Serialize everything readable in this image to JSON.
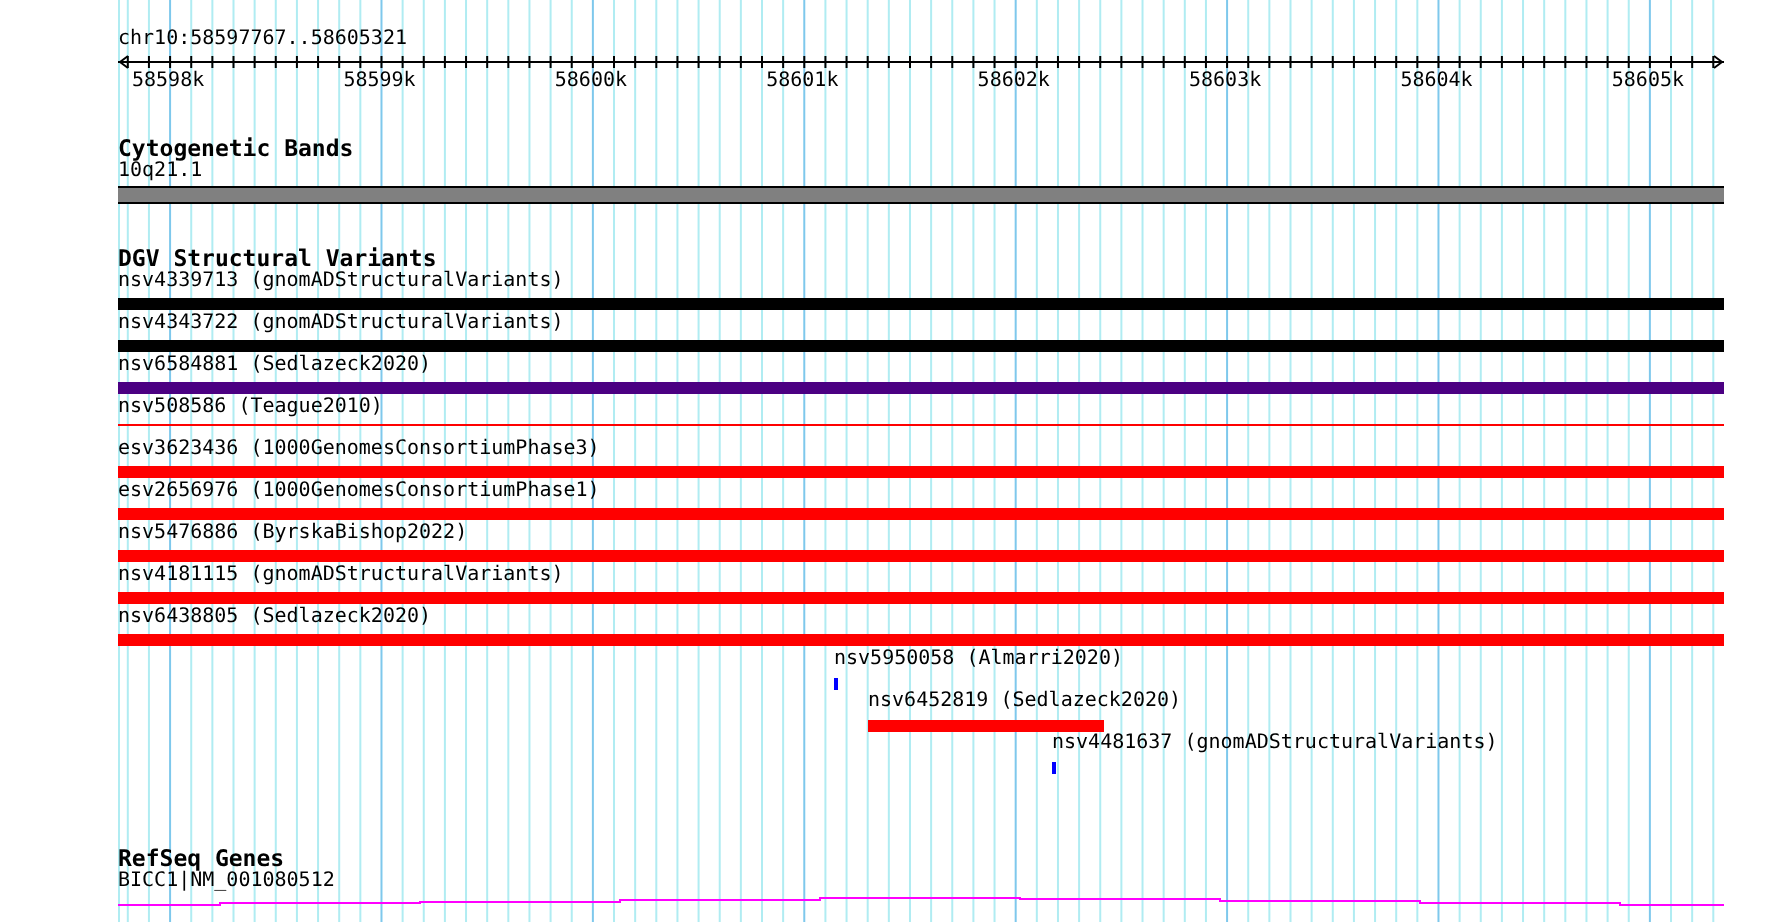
{
  "location": "chr10:58597767..58605321",
  "ruler": {
    "ticks": [
      "58598k",
      "58599k",
      "58600k",
      "58601k",
      "58602k",
      "58603k",
      "58604k",
      "58605k"
    ]
  },
  "cytogenetic_bands": {
    "title": "Cytogenetic Bands",
    "band": "10q21.1",
    "color": "#808080"
  },
  "dgv": {
    "title": "DGV Structural Variants",
    "features": [
      {
        "label": "nsv4339713 (gnomADStructuralVariants)",
        "color": "#000000",
        "kind": "bar"
      },
      {
        "label": "nsv4343722 (gnomADStructuralVariants)",
        "color": "#000000",
        "kind": "bar"
      },
      {
        "label": "nsv6584881 (Sedlazeck2020)",
        "color": "#4b0082",
        "kind": "bar"
      },
      {
        "label": "nsv508586 (Teague2010)",
        "color": "#ff0000",
        "kind": "line"
      },
      {
        "label": "esv3623436 (1000GenomesConsortiumPhase3)",
        "color": "#ff0000",
        "kind": "bar"
      },
      {
        "label": "esv2656976 (1000GenomesConsortiumPhase1)",
        "color": "#ff0000",
        "kind": "bar"
      },
      {
        "label": "nsv5476886 (ByrskaBishop2022)",
        "color": "#ff0000",
        "kind": "bar"
      },
      {
        "label": "nsv4181115 (gnomADStructuralVariants)",
        "color": "#ff0000",
        "kind": "bar"
      },
      {
        "label": "nsv6438805 (Sedlazeck2020)",
        "color": "#ff0000",
        "kind": "bar"
      },
      {
        "label": "nsv5950058 (Almarri2020)",
        "color": "#0000ff",
        "kind": "tick"
      },
      {
        "label": "nsv6452819 (Sedlazeck2020)",
        "color": "#ff0000",
        "kind": "segment"
      },
      {
        "label": "nsv4481637 (gnomADStructuralVariants)",
        "color": "#0000ff",
        "kind": "tick"
      }
    ]
  },
  "refseq": {
    "title": "RefSeq Genes",
    "gene": "BICC1|NM_001080512"
  }
}
